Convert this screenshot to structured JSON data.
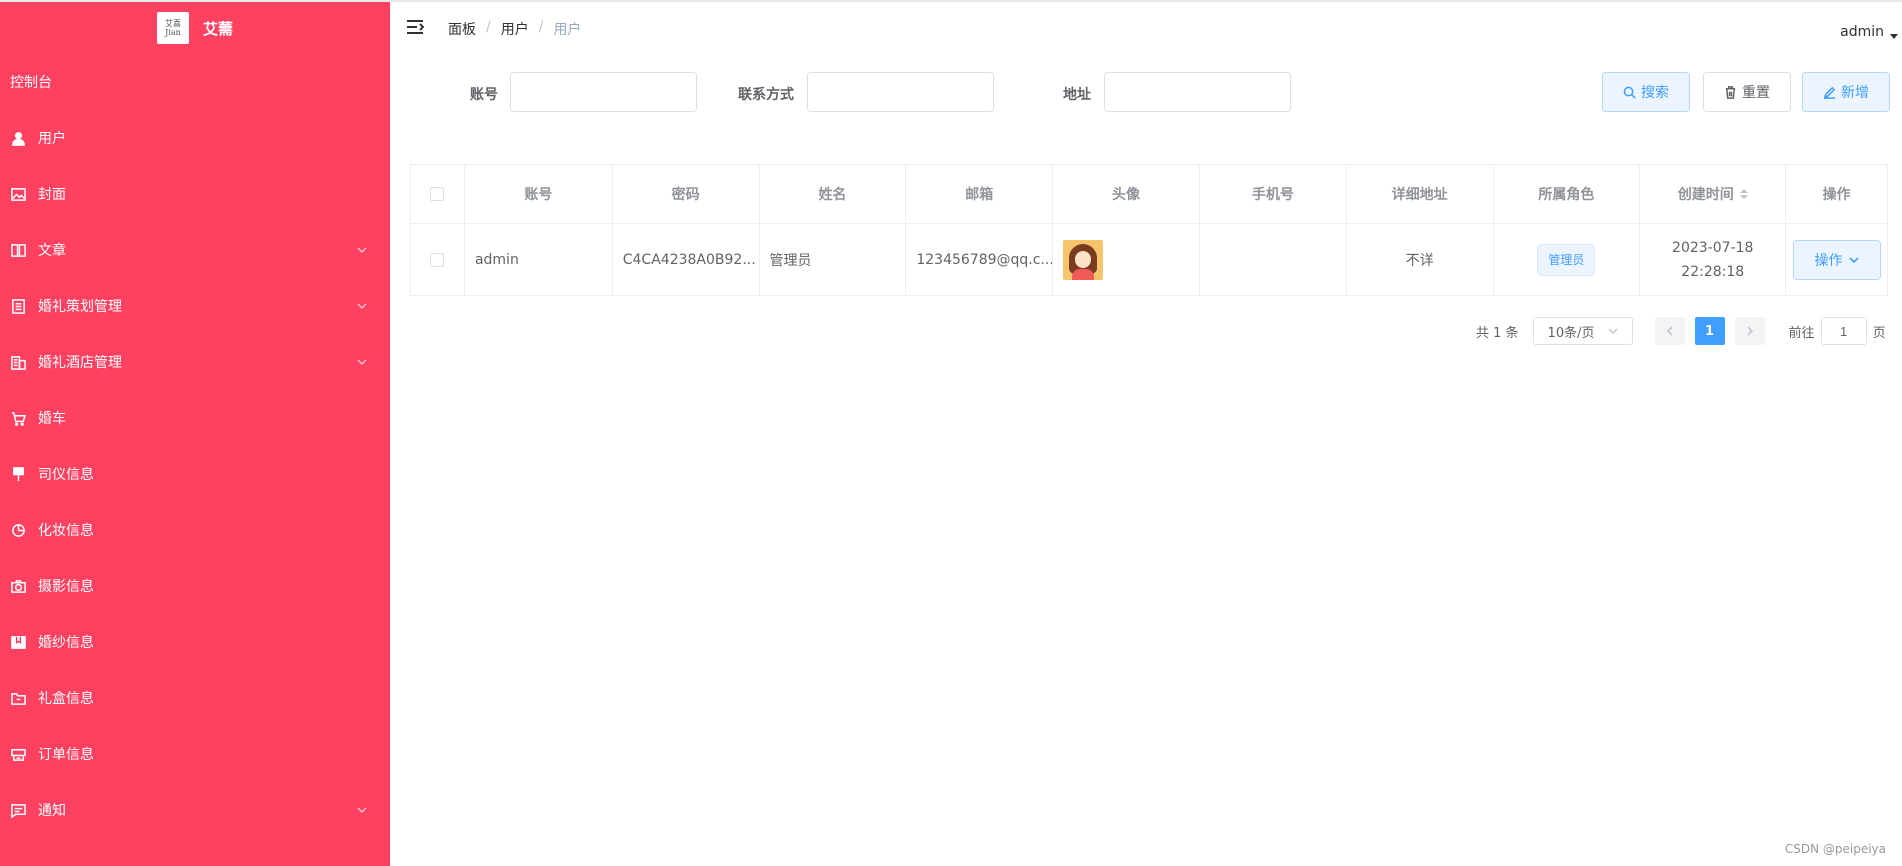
{
  "brand": {
    "logo_text": "艾喜 Jian bride",
    "title": "艾薷"
  },
  "sidebar": {
    "dashboard": "控制台",
    "items": [
      {
        "label": "用户",
        "icon": "user-icon",
        "has_arrow": false
      },
      {
        "label": "封面",
        "icon": "picture-icon",
        "has_arrow": false
      },
      {
        "label": "文章",
        "icon": "book-icon",
        "has_arrow": true
      },
      {
        "label": "婚礼策划管理",
        "icon": "document-icon",
        "has_arrow": true
      },
      {
        "label": "婚礼酒店管理",
        "icon": "building-icon",
        "has_arrow": true
      },
      {
        "label": "婚车",
        "icon": "cart-icon",
        "has_arrow": false
      },
      {
        "label": "司仪信息",
        "icon": "brush-icon",
        "has_arrow": false
      },
      {
        "label": "化妆信息",
        "icon": "pie-icon",
        "has_arrow": false
      },
      {
        "label": "摄影信息",
        "icon": "camera-icon",
        "has_arrow": false
      },
      {
        "label": "婚纱信息",
        "icon": "collection-icon",
        "has_arrow": false
      },
      {
        "label": "礼盒信息",
        "icon": "folder-icon",
        "has_arrow": false
      },
      {
        "label": "订单信息",
        "icon": "box-icon",
        "has_arrow": false
      },
      {
        "label": "通知",
        "icon": "chat-icon",
        "has_arrow": true
      }
    ]
  },
  "header": {
    "breadcrumb": [
      "面板",
      "用户",
      "用户"
    ],
    "user": "admin"
  },
  "search": {
    "account_label": "账号",
    "contact_label": "联系方式",
    "address_label": "地址",
    "account_value": "",
    "contact_value": "",
    "address_value": "",
    "search_button": "搜索",
    "reset_button": "重置",
    "add_button": "新增"
  },
  "table": {
    "columns": [
      "账号",
      "密码",
      "姓名",
      "邮箱",
      "头像",
      "手机号",
      "详细地址",
      "所属角色",
      "创建时间",
      "操作"
    ],
    "rows": [
      {
        "account": "admin",
        "password": "C4CA4238A0B92...",
        "name": "管理员",
        "email": "123456789@qq.c...",
        "phone": "",
        "address": "不详",
        "role": "管理员",
        "created": "2023-07-18 22:28:18",
        "action": "操作"
      }
    ]
  },
  "pagination": {
    "total": "共 1 条",
    "page_size": "10条/页",
    "current_page": "1",
    "goto_label": "前往",
    "goto_value": "1",
    "page_suffix": "页"
  },
  "watermark": "CSDN @peipeiya",
  "colors": {
    "sidebar_bg": "#fe4160",
    "primary": "#409eff"
  }
}
